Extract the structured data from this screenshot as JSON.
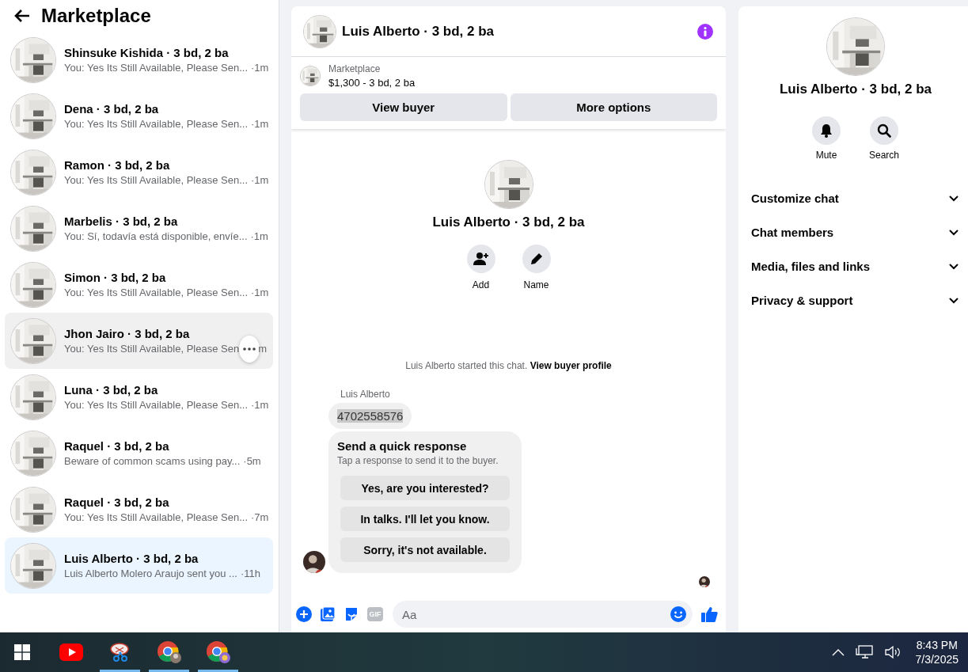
{
  "sidebar": {
    "title": "Marketplace",
    "conversations": [
      {
        "name": "Shinsuke Kishida · 3 bd, 2 ba",
        "preview": "You: Yes Its Still Available, Please Sen...",
        "time": "·1m",
        "selected": false,
        "hovered": false
      },
      {
        "name": "Dena · 3 bd, 2 ba",
        "preview": "You: Yes Its Still Available, Please Sen...",
        "time": "·1m",
        "selected": false,
        "hovered": false
      },
      {
        "name": "Ramon · 3 bd, 2 ba",
        "preview": "You: Yes Its Still Available, Please Sen...",
        "time": "·1m",
        "selected": false,
        "hovered": false
      },
      {
        "name": "Marbelis · 3 bd, 2 ba",
        "preview": "You: Sí, todavía está disponible, envíe...",
        "time": "·1m",
        "selected": false,
        "hovered": false
      },
      {
        "name": "Simon · 3 bd, 2 ba",
        "preview": "You: Yes Its Still Available, Please Sen...",
        "time": "·1m",
        "selected": false,
        "hovered": false
      },
      {
        "name": "Jhon Jairo · 3 bd, 2 ba",
        "preview": "You: Yes Its Still Available, Please Sen",
        "time": "m",
        "selected": false,
        "hovered": true
      },
      {
        "name": "Luna · 3 bd, 2 ba",
        "preview": "You: Yes Its Still Available, Please Sen...",
        "time": "·1m",
        "selected": false,
        "hovered": false
      },
      {
        "name": "Raquel · 3 bd, 2 ba",
        "preview": "Beware of common scams using pay...",
        "time": "·5m",
        "selected": false,
        "hovered": false
      },
      {
        "name": "Raquel · 3 bd, 2 ba",
        "preview": "You: Yes Its Still Available, Please Sen...",
        "time": "·7m",
        "selected": false,
        "hovered": false
      },
      {
        "name": "Luis Alberto · 3 bd, 2 ba",
        "preview": "Luis Alberto Molero Araujo sent you ...",
        "time": "·11h",
        "selected": true,
        "hovered": false
      }
    ]
  },
  "chat": {
    "title": "Luis Alberto · 3 bd, 2 ba",
    "listing": {
      "source": "Marketplace",
      "summary": "$1,300 - 3 bd, 2 ba"
    },
    "buttons": [
      "View buyer",
      "More options"
    ],
    "profile": {
      "name": "Luis Alberto · 3 bd, 2 ba",
      "actions": [
        {
          "kind": "add",
          "label": "Add"
        },
        {
          "kind": "name",
          "label": "Name"
        }
      ]
    },
    "started_notice": {
      "text": "Luis Alberto started this chat.",
      "link": "View buyer profile"
    },
    "messages": [
      {
        "sender": "Luis Alberto",
        "text": "4702558576",
        "highlighted": true
      }
    ],
    "quick_response": {
      "title": "Send a quick response",
      "subtitle": "Tap a response to send it to the buyer.",
      "options": [
        "Yes, are you interested?",
        "In talks. I'll let you know.",
        "Sorry, it's not available."
      ]
    },
    "composer": {
      "gif_label": "GIF",
      "placeholder": "Aa"
    }
  },
  "details": {
    "name": "Luis Alberto · 3 bd, 2 ba",
    "actions": [
      {
        "kind": "mute",
        "label": "Mute"
      },
      {
        "kind": "search",
        "label": "Search"
      }
    ],
    "sections": [
      {
        "label": "Customize chat",
        "expanded": false
      },
      {
        "label": "Chat members",
        "expanded": false
      },
      {
        "label": "Media, files and links",
        "expanded": false
      },
      {
        "label": "Privacy & support",
        "expanded": false
      }
    ]
  },
  "taskbar": {
    "apps": [
      {
        "kind": "youtube",
        "running": false
      },
      {
        "kind": "snipping",
        "running": true
      },
      {
        "kind": "chrome",
        "running": true
      },
      {
        "kind": "chrome-profile",
        "running": true
      }
    ],
    "time": "8:43 PM",
    "date": "7/3/2025"
  }
}
